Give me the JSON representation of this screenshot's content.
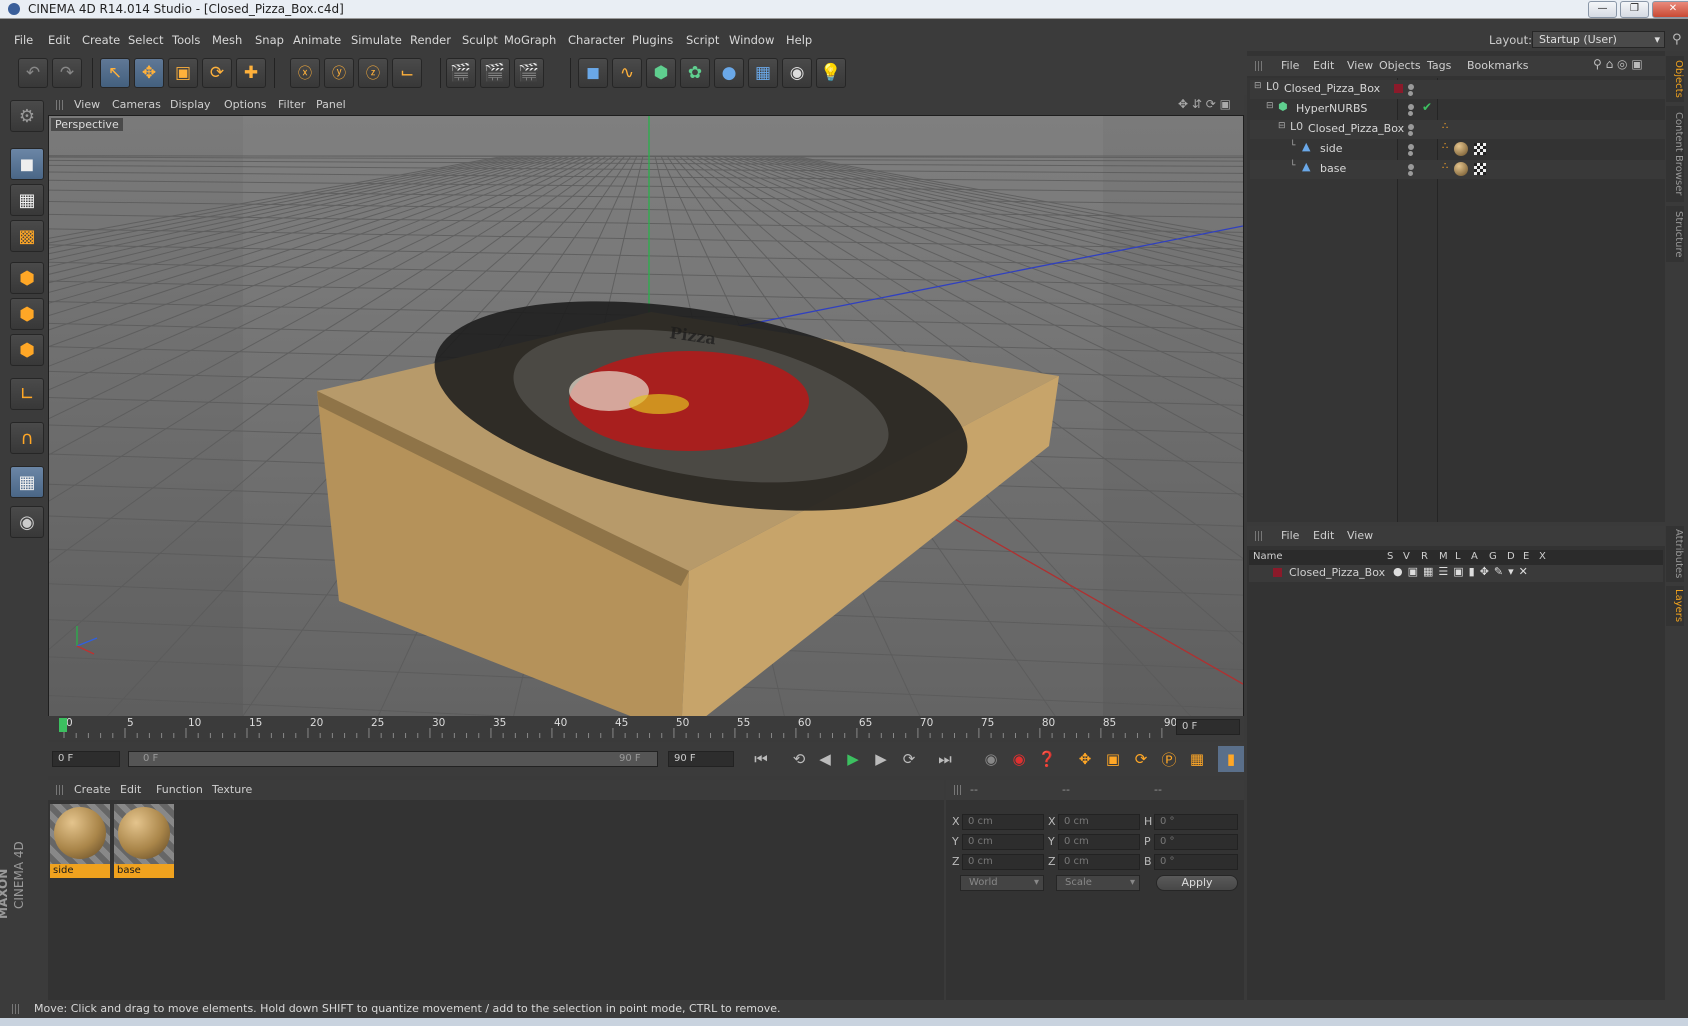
{
  "window": {
    "title": "CINEMA 4D R14.014 Studio - [Closed_Pizza_Box.c4d]"
  },
  "menu": [
    "File",
    "Edit",
    "Create",
    "Select",
    "Tools",
    "Mesh",
    "Snap",
    "Animate",
    "Simulate",
    "Render",
    "Sculpt",
    "MoGraph",
    "Character",
    "Plugins",
    "Script",
    "Window",
    "Help"
  ],
  "layout": {
    "label": "Layout:",
    "value": "Startup (User)"
  },
  "viewport": {
    "menu": [
      "View",
      "Cameras",
      "Display",
      "Options",
      "Filter",
      "Panel"
    ],
    "name": "Perspective",
    "box_text": "Pizza"
  },
  "objects_panel": {
    "menu": [
      "File",
      "Edit",
      "View",
      "Objects",
      "Tags",
      "Bookmarks"
    ],
    "items": [
      {
        "name": "Closed_Pizza_Box",
        "indent": 0
      },
      {
        "name": "HyperNURBS",
        "indent": 1
      },
      {
        "name": "Closed_Pizza_Box",
        "indent": 2
      },
      {
        "name": "side",
        "indent": 3
      },
      {
        "name": "base",
        "indent": 3
      }
    ]
  },
  "layers_panel": {
    "menu": [
      "File",
      "Edit",
      "View"
    ],
    "columns": [
      "Name",
      "S",
      "V",
      "R",
      "M",
      "L",
      "A",
      "G",
      "D",
      "E",
      "X"
    ],
    "rows": [
      {
        "name": "Closed_Pizza_Box"
      }
    ]
  },
  "timeline": {
    "ticks": [
      "0",
      "5",
      "10",
      "15",
      "20",
      "25",
      "30",
      "35",
      "40",
      "45",
      "50",
      "55",
      "60",
      "65",
      "70",
      "75",
      "80",
      "85",
      "90"
    ],
    "current_frame": "0 F"
  },
  "transport": {
    "start": "0 F",
    "range_start": "0 F",
    "range_end": "90 F",
    "end": "90 F"
  },
  "materials": {
    "menu": [
      "Create",
      "Edit",
      "Function",
      "Texture"
    ],
    "items": [
      "side",
      "base"
    ]
  },
  "coordinates": {
    "headers": [
      "--",
      "--",
      "--"
    ],
    "rows": [
      {
        "a": "X",
        "av": "0 cm",
        "b": "X",
        "bv": "0 cm",
        "c": "H",
        "cv": "0 °"
      },
      {
        "a": "Y",
        "av": "0 cm",
        "b": "Y",
        "bv": "0 cm",
        "c": "P",
        "cv": "0 °"
      },
      {
        "a": "Z",
        "av": "0 cm",
        "b": "Z",
        "bv": "0 cm",
        "c": "B",
        "cv": "0 °"
      }
    ],
    "mode1": "World",
    "mode2": "Scale",
    "apply": "Apply"
  },
  "status": "Move: Click and drag to move elements. Hold down SHIFT to quantize movement / add to the selection in point mode, CTRL to remove.",
  "sidetabs": [
    "Objects",
    "Content Browser",
    "Structure",
    "Attributes",
    "Layers"
  ],
  "branding": {
    "maxon": "MAXON",
    "cinema": "CINEMA 4D"
  }
}
